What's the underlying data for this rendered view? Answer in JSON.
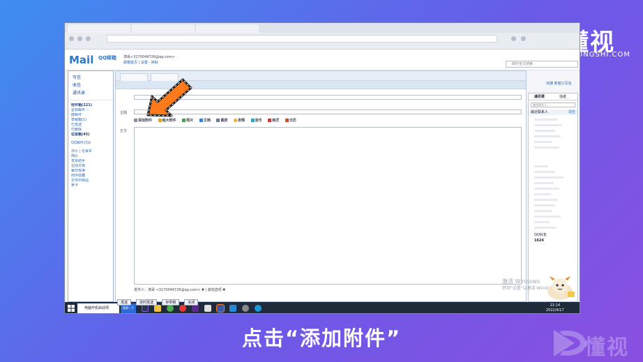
{
  "caption": "点击“添加附件”",
  "brand": {
    "name": "懂视",
    "domain": "51DONGSHI.COM"
  },
  "mail": {
    "logo": "Mail",
    "logo_sub": "QQ邮箱",
    "user_line": "涛哥<3170049726@qq.com>",
    "user_links": "邮箱首页 | 设置 - 换肤",
    "search_placeholder": "邮件全文搜索"
  },
  "sidebar": {
    "actions": [
      "写信",
      "收信",
      "通讯录"
    ],
    "folders": [
      {
        "label": "收件箱(121)",
        "bold": true
      },
      {
        "label": "星标邮件 ☆",
        "bold": false
      },
      {
        "label": "群邮件",
        "bold": false
      },
      {
        "label": "草稿箱(1)",
        "bold": false
      },
      {
        "label": "已发送",
        "bold": false
      },
      {
        "label": "已删除",
        "bold": false
      },
      {
        "label": "垃圾箱(45)",
        "bold": true
      }
    ],
    "more": [
      {
        "label": "QQ邮件订阅"
      },
      {
        "label": "日历 | 记事本"
      },
      {
        "label": "简历"
      },
      {
        "label": "发票助手"
      },
      {
        "label": "在线文档"
      },
      {
        "label": "每日悦读"
      },
      {
        "label": "附件收藏"
      },
      {
        "label": "文件中转站"
      },
      {
        "label": "贺卡"
      }
    ]
  },
  "compose": {
    "subject_label": "主题",
    "body_label": "正文",
    "toolbar": [
      "添加附件",
      "超大附件",
      "照片",
      "文档",
      "截屏",
      "表情",
      "音乐",
      "格式",
      "日历"
    ],
    "sender": "发件人：涛哥 <3170049726@qq.com> ▼  |  其他选项 ▼",
    "right_links": "快捷 新窗口写信"
  },
  "bottom_buttons": [
    "发送",
    "定时发送",
    "存草稿",
    "关闭"
  ],
  "contacts": {
    "tabs": [
      "通讯录",
      "信纸"
    ],
    "search_placeholder": "查找联系人...",
    "header": "最近联系人",
    "header_action": "清空",
    "groups": [
      "QQ好友",
      "1624"
    ]
  },
  "taskbar": {
    "search": "电脑开机启动项",
    "active": "搜索一下",
    "time": "21:14",
    "date": "2022/4/17"
  },
  "watermark": {
    "line1": "激活 Windows",
    "line2": "转到\"设置\"以激活 Windows。"
  },
  "colors": {
    "accent": "#ff7a1a",
    "link": "#2c67b6",
    "frame": "#9fb4d6"
  }
}
